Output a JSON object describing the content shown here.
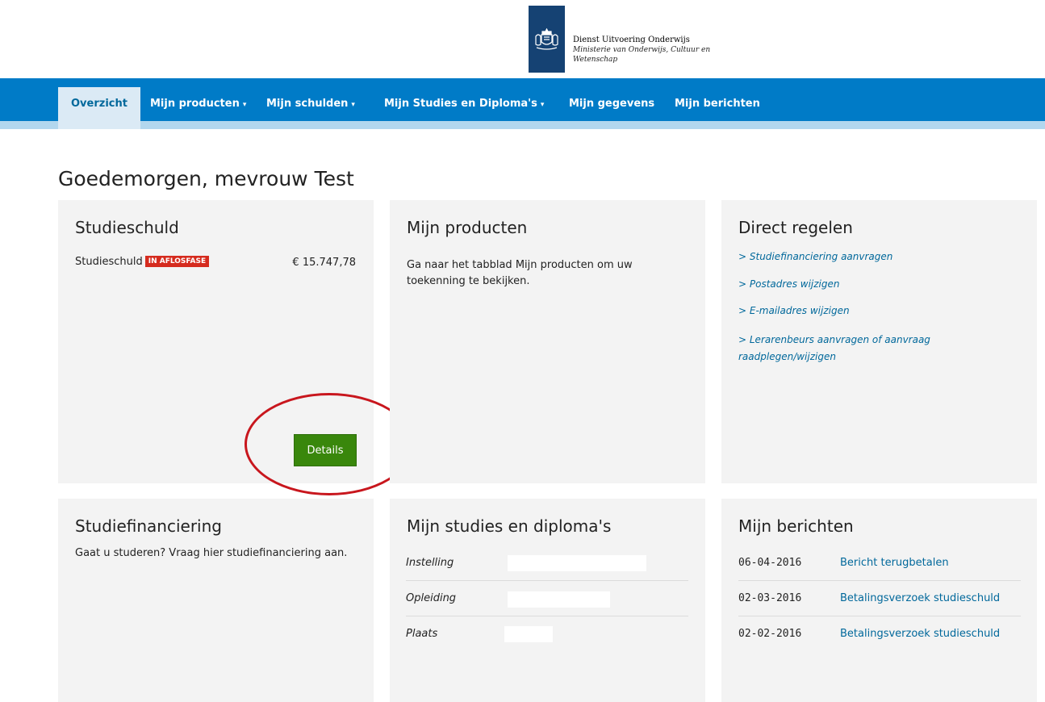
{
  "logo": {
    "name": "Dienst Uitvoering Onderwijs",
    "subtitle": "Ministerie van Onderwijs, Cultuur en Wetenschap",
    "crest_icon": "rijksoverheid-crest-icon"
  },
  "nav": {
    "items": [
      {
        "label": "Overzicht",
        "dropdown": false,
        "active": true
      },
      {
        "label": "Mijn producten",
        "dropdown": true
      },
      {
        "label": "Mijn schulden",
        "dropdown": true
      },
      {
        "label": "Mijn Studies en Diploma's",
        "dropdown": true
      },
      {
        "label": "Mijn gegevens",
        "dropdown": false
      },
      {
        "label": "Mijn berichten",
        "dropdown": false
      }
    ],
    "caret": "▾"
  },
  "greeting": "Goedemorgen, mevrouw  Test",
  "studieschuld": {
    "title": "Studieschuld",
    "label": "Studieschuld",
    "badge": "IN AFLOSFASE",
    "amount": "€ 15.747,78",
    "details_button": "Details"
  },
  "mijn_producten": {
    "title": "Mijn producten",
    "text": "Ga naar het tabblad Mijn producten om uw toekenning te bekijken."
  },
  "direct_regelen": {
    "title": "Direct regelen",
    "links": [
      "> Studiefinanciering aanvragen",
      "> Postadres wijzigen",
      "> E-mailadres wijzigen",
      "> Lerarenbeurs aanvragen of aanvraag raadplegen/wijzigen"
    ]
  },
  "studiefinanciering": {
    "title": "Studiefinanciering",
    "text": "Gaat u studeren? Vraag hier studiefinanciering aan."
  },
  "studies_diplomas": {
    "title": "Mijn studies en diploma's",
    "rows": [
      {
        "label": "Instelling",
        "value": ""
      },
      {
        "label": "Opleiding",
        "value": ""
      },
      {
        "label": "Plaats",
        "value": ""
      }
    ]
  },
  "mijn_berichten": {
    "title": "Mijn berichten",
    "messages": [
      {
        "date": "06-04-2016",
        "subject": "Bericht terugbetalen"
      },
      {
        "date": "02-03-2016",
        "subject": "Betalingsverzoek studieschuld"
      },
      {
        "date": "02-02-2016",
        "subject": "Betalingsverzoek studieschuld"
      }
    ]
  },
  "colors": {
    "navbar": "#007bc7",
    "logo_block": "#154273",
    "badge": "#d52b1e",
    "details_button": "#39870c",
    "link": "#01689b",
    "annotation_circle": "#c8161d"
  }
}
